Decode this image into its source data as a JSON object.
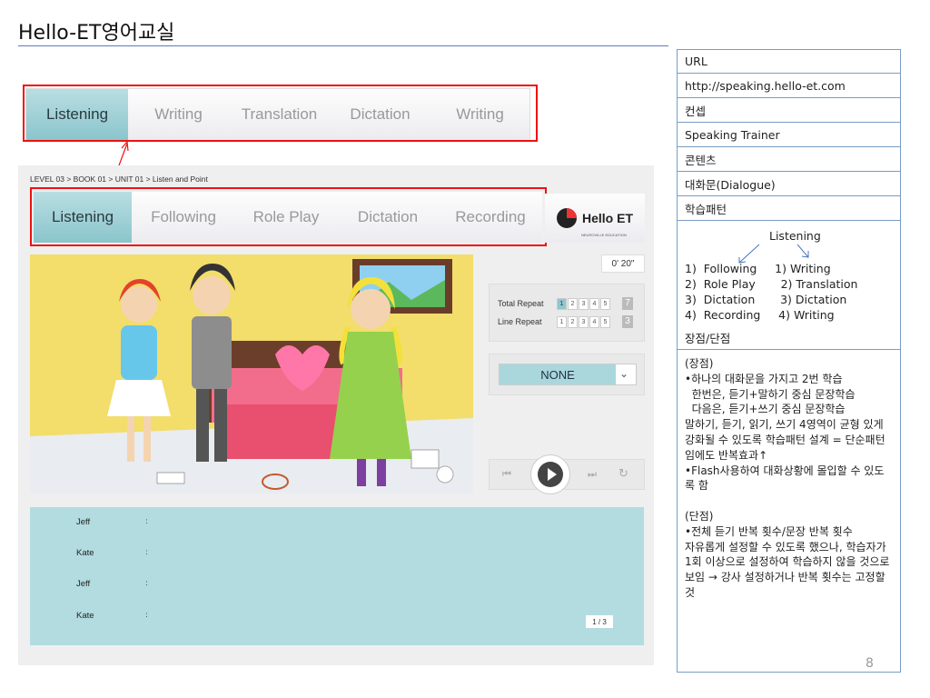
{
  "title": "Hello-ET영어교실",
  "annotation_tabs": [
    "Listening",
    "Writing",
    "Translation",
    "Dictation",
    "Writing"
  ],
  "app": {
    "breadcrumb": "LEVEL 03 > BOOK 01 > UNIT 01 > Listen and Point",
    "tabs": [
      "Listening",
      "Following",
      "Role Play",
      "Dictation",
      "Recording"
    ],
    "logo": {
      "text": "Hello ET",
      "sub": "NEUROVILLE EDUCATION"
    },
    "timer": "0' 20\"",
    "total_repeat": {
      "label": "Total Repeat",
      "options": [
        "1",
        "2",
        "3",
        "4",
        "5"
      ],
      "selected": "1",
      "value": "7"
    },
    "line_repeat": {
      "label": "Line Repeat",
      "options": [
        "1",
        "2",
        "3",
        "4",
        "5"
      ],
      "value": "3"
    },
    "select_value": "NONE",
    "dialogue": [
      {
        "speaker": "Jeff",
        "sep": ":"
      },
      {
        "speaker": "Kate",
        "sep": ":"
      },
      {
        "speaker": "Jeff",
        "sep": ":"
      },
      {
        "speaker": "Kate",
        "sep": ":"
      }
    ],
    "page": "1 / 3"
  },
  "panel": {
    "url_label": "URL",
    "url_value": "http://speaking.hello-et.com",
    "concept_label": "컨셉",
    "concept_value": "Speaking Trainer",
    "contents_label": "콘텐츠",
    "contents_value": "대화문(Dialogue)",
    "pattern_label": "학습패턴",
    "pattern_title": "Listening",
    "pattern_lines": [
      "1)  Following     1) Writing",
      "2)  Role Play       2) Translation",
      "3)  Dictation       3) Dictation",
      "4)  Recording     4) Writing"
    ],
    "proscons_label": "장점/단점",
    "proscons_text": "(장점)\n•하나의 대화문을 가지고 2번 학습\n  한번은, 듣기+말하기 중심 문장학습\n  다음은, 듣기+쓰기 중심 문장학습\n말하기, 듣기, 읽기, 쓰기 4영역이 균형 있게 강화될 수 있도록 학습패턴 설계 = 단순패턴임에도 반복효과↑\n•Flash사용하여 대화상황에 몰입할 수 있도록 함\n\n(단점)\n•전체 듣기 반복 횟수/문장 반복 횟수\n자유롭게 설정할 수 있도록 했으나, 학습자가 1회 이상으로 설정하여 학습하지 않을 것으로 보임 → 강사 설정하거나 반복 횟수는 고정할 것",
    "page_number": "8"
  }
}
